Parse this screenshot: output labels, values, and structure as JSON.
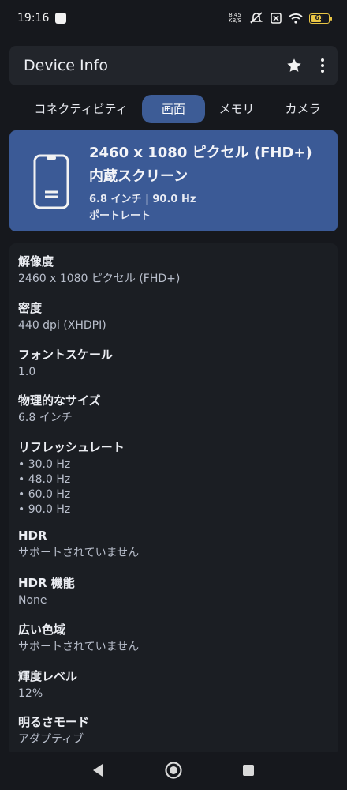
{
  "status": {
    "time": "19:16",
    "net_speed_value": "8.45",
    "net_speed_unit": "KB/S",
    "battery_level": "61",
    "battery_fill": 0.61
  },
  "appbar": {
    "title": "Device Info"
  },
  "tabs": [
    {
      "label": "コネクティビティ"
    },
    {
      "label": "画面",
      "active": true
    },
    {
      "label": "メモリ"
    },
    {
      "label": "カメラ"
    }
  ],
  "hero": {
    "resolution": "2460 x 1080 ピクセル (FHD+)",
    "screen_type": "内蔵スクリーン",
    "size_rate": "6.8 インチ | 90.0 Hz",
    "orientation": "ポートレート"
  },
  "details": {
    "resolution": {
      "label": "解像度",
      "value": "2460 x 1080 ピクセル (FHD+)"
    },
    "density": {
      "label": "密度",
      "value": "440 dpi (XHDPI)"
    },
    "font_scale": {
      "label": "フォントスケール",
      "value": "1.0"
    },
    "physical_size": {
      "label": "物理的なサイズ",
      "value": "6.8 インチ"
    },
    "refresh_rate": {
      "label": "リフレッシュレート",
      "values": [
        "• 30.0 Hz",
        "• 48.0 Hz",
        "• 60.0 Hz",
        "• 90.0 Hz"
      ]
    },
    "hdr": {
      "label": "HDR",
      "value": "サポートされていません"
    },
    "hdr_capability": {
      "label": "HDR 機能",
      "value": "None"
    },
    "wide_gamut": {
      "label": "広い色域",
      "value": "サポートされていません"
    },
    "brightness_level": {
      "label": "輝度レベル",
      "value": "12%"
    },
    "brightness_mode": {
      "label": "明るさモード",
      "value": "アダプティブ"
    }
  },
  "colors": {
    "accent": "#3b5a96",
    "background": "#16181d",
    "card": "#1b1e23"
  },
  "icons": {
    "star": "star-icon",
    "more": "more-vert-icon",
    "phone": "smartphone-icon",
    "back": "back-icon",
    "home": "home-icon",
    "recents": "recents-icon"
  }
}
